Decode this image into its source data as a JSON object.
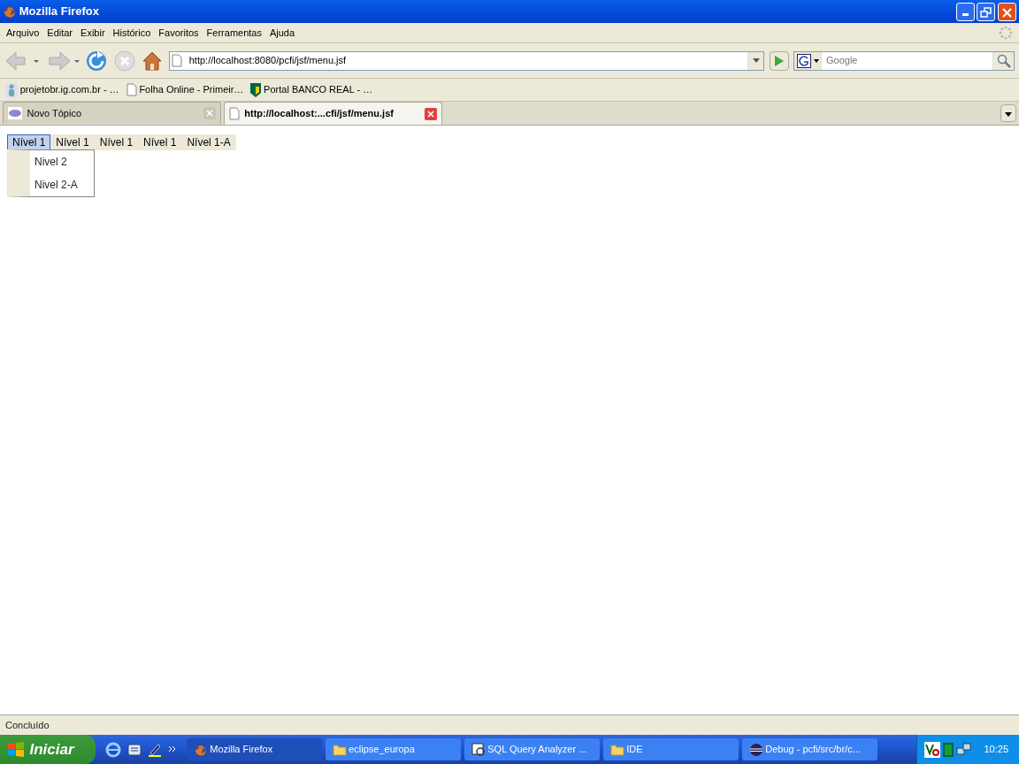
{
  "window": {
    "title": "Mozilla Firefox"
  },
  "menu_bar": [
    "Arquivo",
    "Editar",
    "Exibir",
    "Histórico",
    "Favoritos",
    "Ferramentas",
    "Ajuda"
  ],
  "address_bar": {
    "value": "http://localhost:8080/pcfi/jsf/menu.jsf"
  },
  "search_bar": {
    "placeholder": "Google"
  },
  "bookmarks": [
    {
      "label": "projetobr.ig.com.br - …",
      "kind": "person"
    },
    {
      "label": "Folha Online - Primeir…",
      "kind": "page"
    },
    {
      "label": "Portal BANCO REAL - …",
      "kind": "bank"
    }
  ],
  "tabs": [
    {
      "label": "Novo Tópico",
      "selected": false,
      "kind": "forum"
    },
    {
      "label": "http://localhost:...cfi/jsf/menu.jsf",
      "selected": true,
      "kind": "page"
    }
  ],
  "page_menu": {
    "items": [
      {
        "label": "Nível 1",
        "selected": true
      },
      {
        "label": "Nível 1",
        "selected": false
      },
      {
        "label": "Nível 1",
        "selected": false
      },
      {
        "label": "Nível 1",
        "selected": false
      },
      {
        "label": "Nível 1-A",
        "selected": false
      }
    ],
    "submenu": [
      "Nivel 2",
      "Nivel 2-A"
    ]
  },
  "status_bar": "Concluído",
  "taskbar": {
    "start": "Iniciar",
    "buttons": [
      {
        "label": "Mozilla Firefox",
        "selected": true,
        "kind": "firefox"
      },
      {
        "label": "eclipse_europa",
        "selected": false,
        "kind": "folder"
      },
      {
        "label": "SQL Query Analyzer ...",
        "selected": false,
        "kind": "sql"
      },
      {
        "label": "IDE",
        "selected": false,
        "kind": "folder"
      },
      {
        "label": "Debug - pcfi/src/br/c...",
        "selected": false,
        "kind": "eclipse"
      }
    ],
    "clock": "10:25"
  }
}
